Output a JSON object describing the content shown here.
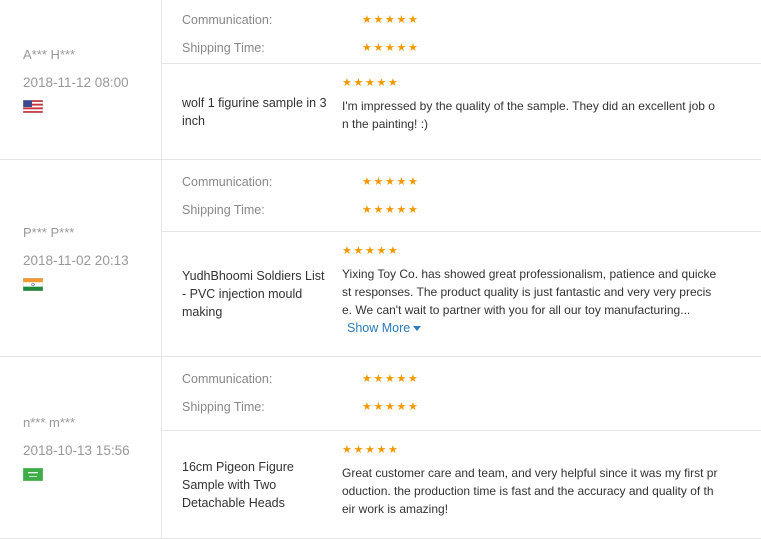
{
  "labels": {
    "communication": "Communication:",
    "shipping_time": "Shipping Time:",
    "show_more": "Show More"
  },
  "star_glyph": "★",
  "colors": {
    "star": "#f29900",
    "link": "#2b7bc0"
  },
  "reviews": [
    {
      "buyer": "A*** H***",
      "date": "2018-11-12 08:00",
      "flag": "us-flag",
      "communication_rating": 5,
      "shipping_rating": 5,
      "product_rating": 5,
      "product": "wolf 1 figurine sample in 3 inch",
      "text": "I'm impressed by the quality of the sample. They did an excellent job on the painting! :)"
    },
    {
      "buyer": "P*** P***",
      "date": "2018-11-02 20:13",
      "flag": "india-flag",
      "communication_rating": 5,
      "shipping_rating": 5,
      "product_rating": 5,
      "product": "YudhBhoomi Soldiers List - PVC injection mould making",
      "text": "Yixing Toy Co. has showed great professionalism, patience and quickest responses. The product quality is just fantastic and very very precise. We can't wait to partner with you for all our toy manufacturing..."
    },
    {
      "buyer": "n*** m***",
      "date": "2018-10-13 15:56",
      "flag": "saudi-flag",
      "communication_rating": 5,
      "shipping_rating": 5,
      "product_rating": 5,
      "product": "16cm Pigeon Figure Sample with Two Detachable Heads",
      "text": "Great customer care and team, and very helpful since it was my first production. the production time is fast and the accuracy and quality of their work is amazing!"
    }
  ]
}
